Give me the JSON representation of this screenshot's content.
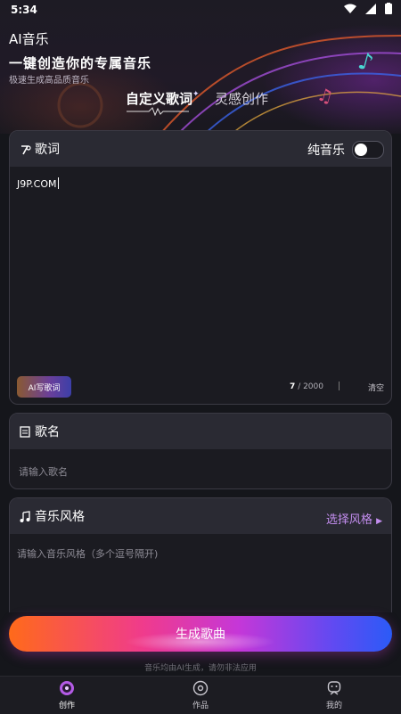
{
  "status": {
    "time": "5:34"
  },
  "header": {
    "app_title": "AI音乐",
    "headline": "一键创造你的专属音乐",
    "subline": "极速生成高品质音乐"
  },
  "tabs": [
    {
      "label": "自定义歌词",
      "active": true
    },
    {
      "label": "灵感创作",
      "active": false
    }
  ],
  "lyrics": {
    "title": "歌词",
    "toggle_label": "纯音乐",
    "toggle_on": false,
    "value": "J9P.COM",
    "ai_button": "AI写歌词",
    "count": "7",
    "max": "/ 2000",
    "clear": "清空"
  },
  "song_name": {
    "title": "歌名",
    "placeholder": "请输入歌名"
  },
  "music_style": {
    "title": "音乐风格",
    "select_label": "选择风格",
    "placeholder": "请输入音乐风格（多个逗号隔开)"
  },
  "generate_button": "生成歌曲",
  "disclaimer": "音乐均由AI生成，请勿非法应用",
  "nav": [
    {
      "label": "创作",
      "icon": "create-icon",
      "active": true
    },
    {
      "label": "作品",
      "icon": "works-icon",
      "active": false
    },
    {
      "label": "我的",
      "icon": "profile-icon",
      "active": false
    }
  ],
  "colors": {
    "accent": "#c48ef0",
    "background": "#15161b",
    "card": "#2a2a33"
  }
}
